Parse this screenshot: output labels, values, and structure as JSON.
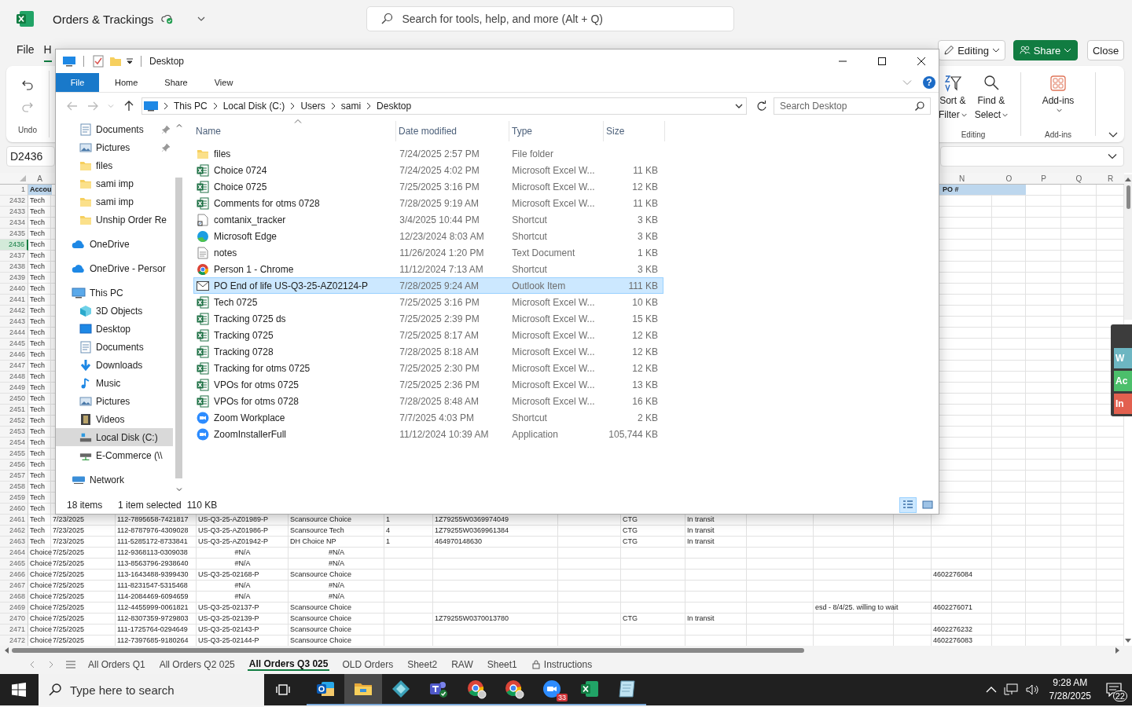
{
  "excel": {
    "title": "Orders & Trackings",
    "search": {
      "placeholder": "Search for tools, help, and more (Alt + Q)"
    },
    "menu_tabs": [
      {
        "label": "File",
        "selected": false
      },
      {
        "label": "H",
        "selected": true
      }
    ],
    "header_buttons": [
      {
        "kind": "editing",
        "label": "Editing"
      },
      {
        "kind": "share",
        "label": "Share"
      },
      {
        "kind": "close",
        "label": "Close"
      }
    ],
    "ribbon": {
      "undo_group": "Undo",
      "editing_commands": [
        {
          "kind": "sort",
          "line1": "Sort &",
          "line2": "Filter"
        },
        {
          "kind": "find",
          "line1": "Find &",
          "line2": "Select"
        }
      ],
      "editing_group": "Editing",
      "addins_command": "Add-ins",
      "addins_group": "Add-ins"
    },
    "name_box": "D2436",
    "column_headers": {
      "column_a": "A",
      "column_n": "N",
      "column_o": "O",
      "column_p": "P",
      "column_q": "Q",
      "column_r": "R"
    },
    "rows": [
      {
        "n": "1",
        "kind": "header",
        "selected": false,
        "column_a": "Accou",
        "column_n": "PO #"
      },
      {
        "n": "2432",
        "kind": "normal",
        "selected": false,
        "column_a": "Tech"
      },
      {
        "n": "2433",
        "kind": "normal",
        "selected": false,
        "column_a": "Tech"
      },
      {
        "n": "2434",
        "kind": "normal",
        "selected": false,
        "column_a": "Tech"
      },
      {
        "n": "2435",
        "kind": "normal",
        "selected": false,
        "column_a": "Tech"
      },
      {
        "n": "2436",
        "kind": "normal",
        "selected": true,
        "column_a": "Tech"
      },
      {
        "n": "2437",
        "kind": "normal",
        "selected": false,
        "column_a": "Tech"
      },
      {
        "n": "2438",
        "kind": "normal",
        "selected": false,
        "column_a": "Tech"
      },
      {
        "n": "2439",
        "kind": "normal",
        "selected": false,
        "column_a": "Tech"
      },
      {
        "n": "2440",
        "kind": "normal",
        "selected": false,
        "column_a": "Tech"
      },
      {
        "n": "2441",
        "kind": "normal",
        "selected": false,
        "column_a": "Tech"
      },
      {
        "n": "2442",
        "kind": "normal",
        "selected": false,
        "column_a": "Tech"
      },
      {
        "n": "2443",
        "kind": "normal",
        "selected": false,
        "column_a": "Tech"
      },
      {
        "n": "2444",
        "kind": "normal",
        "selected": false,
        "column_a": "Tech"
      },
      {
        "n": "2445",
        "kind": "normal",
        "selected": false,
        "column_a": "Tech"
      },
      {
        "n": "2446",
        "kind": "normal",
        "selected": false,
        "column_a": "Tech"
      },
      {
        "n": "2447",
        "kind": "normal",
        "selected": false,
        "column_a": "Tech"
      },
      {
        "n": "2448",
        "kind": "normal",
        "selected": false,
        "column_a": "Tech"
      },
      {
        "n": "2449",
        "kind": "normal",
        "selected": false,
        "column_a": "Tech"
      },
      {
        "n": "2450",
        "kind": "normal",
        "selected": false,
        "column_a": "Tech"
      },
      {
        "n": "2451",
        "kind": "normal",
        "selected": false,
        "column_a": "Tech"
      },
      {
        "n": "2452",
        "kind": "normal",
        "selected": false,
        "column_a": "Tech"
      },
      {
        "n": "2453",
        "kind": "normal",
        "selected": false,
        "column_a": "Tech"
      },
      {
        "n": "2454",
        "kind": "normal",
        "selected": false,
        "column_a": "Tech"
      },
      {
        "n": "2455",
        "kind": "normal",
        "selected": false,
        "column_a": "Tech"
      },
      {
        "n": "2456",
        "kind": "normal",
        "selected": false,
        "column_a": "Tech"
      },
      {
        "n": "2457",
        "kind": "normal",
        "selected": false,
        "column_a": "Tech"
      },
      {
        "n": "2458",
        "kind": "normal",
        "selected": false,
        "column_a": "Tech"
      },
      {
        "n": "2459",
        "kind": "normal",
        "selected": false,
        "column_a": "Tech"
      },
      {
        "n": "2460",
        "kind": "normal",
        "selected": false,
        "column_a": "Tech"
      },
      {
        "n": "2461",
        "kind": "normal",
        "selected": false,
        "column_a": "Tech",
        "column_b": "7/23/2025",
        "column_c": "112-7895658-7421817",
        "column_d": "US-Q3-25-AZ01989-P",
        "column_e": "Scansource Choice",
        "column_f": "1",
        "column_g": "1Z79255W0369974049",
        "column_i": "CTG",
        "column_j": "In transit"
      },
      {
        "n": "2462",
        "kind": "normal",
        "selected": false,
        "column_a": "Tech",
        "column_b": "7/23/2025",
        "column_c": "112-8787976-4309028",
        "column_d": "US-Q3-25-AZ01986-P",
        "column_e": "Scansource Tech",
        "column_f": "4",
        "column_g": "1Z79255W0369961384",
        "column_i": "CTG",
        "column_j": "In transit"
      },
      {
        "n": "2463",
        "kind": "normal",
        "selected": false,
        "column_a": "Tech",
        "column_b": "7/23/2025",
        "column_c": "111-5285172-8733841",
        "column_d": "US-Q3-25-AZ01942-P",
        "column_e": "DH Choice NP",
        "column_f": "1",
        "column_g": "464970148630",
        "column_i": "CTG",
        "column_j": "In transit"
      },
      {
        "n": "2464",
        "kind": "missing",
        "selected": false,
        "column_a": "Choice",
        "column_b": "7/25/2025",
        "column_c": "112-9368113-0309038",
        "column_d": "#N/A",
        "column_e": "#N/A"
      },
      {
        "n": "2465",
        "kind": "missing",
        "selected": false,
        "column_a": "Choice",
        "column_b": "7/25/2025",
        "column_c": "113-8563796-2938640",
        "column_d": "#N/A",
        "column_e": "#N/A"
      },
      {
        "n": "2466",
        "kind": "normal",
        "selected": false,
        "column_a": "Choice",
        "column_b": "7/25/2025",
        "column_c": "113-1643488-9399430",
        "column_d": "US-Q3-25-02168-P",
        "column_e": "Scansource Choice",
        "column_n": "4602276084"
      },
      {
        "n": "2467",
        "kind": "missing",
        "selected": false,
        "column_a": "Choice",
        "column_b": "7/25/2025",
        "column_c": "111-8231547-5315468",
        "column_d": "#N/A",
        "column_e": "#N/A"
      },
      {
        "n": "2468",
        "kind": "missing",
        "selected": false,
        "column_a": "Choice",
        "column_b": "7/25/2025",
        "column_c": "114-2084469-6094659",
        "column_d": "#N/A",
        "column_e": "#N/A"
      },
      {
        "n": "2469",
        "kind": "normal",
        "selected": false,
        "column_a": "Choice",
        "column_b": "7/25/2025",
        "column_c": "112-4455999-0061821",
        "column_d": "US-Q3-25-02137-P",
        "column_e": "Scansource Choice",
        "column_l": "esd -  8/4/25. willing to wait",
        "column_n": "4602276071"
      },
      {
        "n": "2470",
        "kind": "normal",
        "selected": false,
        "column_a": "Choice",
        "column_b": "7/25/2025",
        "column_c": "112-8307359-9729803",
        "column_d": "US-Q3-25-02139-P",
        "column_e": "Scansource Choice",
        "column_g": "1Z79255W0370013780",
        "column_i": "CTG",
        "column_j": "In transit"
      },
      {
        "n": "2471",
        "kind": "normal",
        "selected": false,
        "column_a": "Choice",
        "column_b": "7/25/2025",
        "column_c": "111-1725764-0294649",
        "column_d": "US-Q3-25-02143-P",
        "column_e": "Scansource Choice",
        "column_n": "4602276232"
      },
      {
        "n": "2472",
        "kind": "normal",
        "selected": false,
        "column_a": "Choice",
        "column_b": "7/25/2025",
        "column_c": "112-7397685-9180264",
        "column_d": "US-Q3-25-02144-P",
        "column_e": "Scansource Choice",
        "column_n": "4602276083"
      }
    ],
    "side_widget": [
      {
        "label": "W",
        "color": "#6db6c2"
      },
      {
        "label": "Ac",
        "color": "#4cbf6b"
      },
      {
        "label": "In",
        "color": "#e2604f"
      }
    ],
    "sheet_tabs": [
      {
        "label": "All Orders Q1",
        "selected": false,
        "locked": false
      },
      {
        "label": "All Orders Q2 025",
        "selected": false,
        "locked": false
      },
      {
        "label": "All Orders Q3 025",
        "selected": true,
        "locked": false
      },
      {
        "label": "OLD Orders",
        "selected": false,
        "locked": false
      },
      {
        "label": "Sheet2",
        "selected": false,
        "locked": false
      },
      {
        "label": "RAW",
        "selected": false,
        "locked": false
      },
      {
        "label": "Sheet1",
        "selected": false,
        "locked": false
      },
      {
        "label": "Instructions",
        "selected": false,
        "locked": true
      }
    ]
  },
  "explorer": {
    "title": "Desktop",
    "ribbon_tabs": [
      {
        "label": "File",
        "selected": true
      },
      {
        "label": "Home",
        "selected": false
      },
      {
        "label": "Share",
        "selected": false
      },
      {
        "label": "View",
        "selected": false
      }
    ],
    "help": "?",
    "breadcrumb": [
      "This PC",
      "Local Disk (C:)",
      "Users",
      "sami",
      "Desktop"
    ],
    "search": {
      "placeholder": "Search Desktop"
    },
    "quick_access": [
      {
        "label": "Documents",
        "kind": "documents",
        "pinned": true,
        "selected": false
      },
      {
        "label": "Pictures",
        "kind": "pictures",
        "pinned": true,
        "selected": false
      },
      {
        "label": "files",
        "kind": "folder",
        "pinned": false,
        "selected": false
      },
      {
        "label": "sami imp",
        "kind": "folder",
        "pinned": false,
        "selected": false
      },
      {
        "label": "sami imp",
        "kind": "folder",
        "pinned": false,
        "selected": false
      },
      {
        "label": "Unship Order Re",
        "kind": "folder",
        "pinned": false,
        "selected": false
      }
    ],
    "tree": [
      {
        "label": "OneDrive",
        "kind": "cloud",
        "selected": false
      },
      {
        "label": "OneDrive - Persor",
        "kind": "cloud",
        "selected": false
      },
      {
        "label": "This PC",
        "kind": "pc",
        "selected": false,
        "children": [
          {
            "label": "3D Objects",
            "kind": "cube",
            "selected": false
          },
          {
            "label": "Desktop",
            "kind": "desktop",
            "selected": false
          },
          {
            "label": "Documents",
            "kind": "documents",
            "selected": false
          },
          {
            "label": "Downloads",
            "kind": "download",
            "selected": false
          },
          {
            "label": "Music",
            "kind": "music",
            "selected": false
          },
          {
            "label": "Pictures",
            "kind": "pictures",
            "selected": false
          },
          {
            "label": "Videos",
            "kind": "videos",
            "selected": false
          },
          {
            "label": "Local Disk (C:)",
            "kind": "disk",
            "selected": true
          },
          {
            "label": "E-Commerce (\\\\",
            "kind": "netdrive",
            "selected": false
          }
        ]
      },
      {
        "label": "Network",
        "kind": "network",
        "selected": false
      }
    ],
    "columns": [
      "Name",
      "Date modified",
      "Type",
      "Size"
    ],
    "files": [
      {
        "name": "files",
        "date": "7/24/2025 2:57 PM",
        "type": "File folder",
        "kind": "folder",
        "selected": false
      },
      {
        "name": "Choice 0724",
        "date": "7/24/2025 4:02 PM",
        "type": "Microsoft Excel W...",
        "size": "11 KB",
        "kind": "excel",
        "selected": false
      },
      {
        "name": "Choice 0725",
        "date": "7/25/2025 3:16 PM",
        "type": "Microsoft Excel W...",
        "size": "12 KB",
        "kind": "excel",
        "selected": false
      },
      {
        "name": "Comments for otms 0728",
        "date": "7/28/2025 9:19 AM",
        "type": "Microsoft Excel W...",
        "size": "11 KB",
        "kind": "excel",
        "selected": false
      },
      {
        "name": "comtanix_tracker",
        "date": "3/4/2025 10:44 PM",
        "type": "Shortcut",
        "size": "3 KB",
        "kind": "shortcut",
        "selected": false
      },
      {
        "name": "Microsoft Edge",
        "date": "12/23/2024 8:03 AM",
        "type": "Shortcut",
        "size": "3 KB",
        "kind": "edge",
        "selected": false
      },
      {
        "name": "notes",
        "date": "11/26/2024 1:20 PM",
        "type": "Text Document",
        "size": "1 KB",
        "kind": "text",
        "selected": false
      },
      {
        "name": "Person 1 - Chrome",
        "date": "11/12/2024 7:13 AM",
        "type": "Shortcut",
        "size": "3 KB",
        "kind": "chrome",
        "selected": false
      },
      {
        "name": "PO End of life  US-Q3-25-AZ02124-P",
        "date": "7/28/2025 9:24 AM",
        "type": "Outlook Item",
        "size": "111 KB",
        "kind": "mail",
        "selected": true
      },
      {
        "name": "Tech 0725",
        "date": "7/25/2025 3:16 PM",
        "type": "Microsoft Excel W...",
        "size": "10 KB",
        "kind": "excel",
        "selected": false
      },
      {
        "name": "Tracking 0725 ds",
        "date": "7/25/2025 2:39 PM",
        "type": "Microsoft Excel W...",
        "size": "15 KB",
        "kind": "excel",
        "selected": false
      },
      {
        "name": "Tracking 0725",
        "date": "7/25/2025 8:17 AM",
        "type": "Microsoft Excel W...",
        "size": "12 KB",
        "kind": "excel",
        "selected": false
      },
      {
        "name": "Tracking 0728",
        "date": "7/28/2025 8:18 AM",
        "type": "Microsoft Excel W...",
        "size": "12 KB",
        "kind": "excel",
        "selected": false
      },
      {
        "name": "Tracking for otms 0725",
        "date": "7/25/2025 2:30 PM",
        "type": "Microsoft Excel W...",
        "size": "12 KB",
        "kind": "excel",
        "selected": false
      },
      {
        "name": "VPOs for otms 0725",
        "date": "7/25/2025 2:36 PM",
        "type": "Microsoft Excel W...",
        "size": "13 KB",
        "kind": "excel",
        "selected": false
      },
      {
        "name": "VPOs for otms 0728",
        "date": "7/28/2025 8:48 AM",
        "type": "Microsoft Excel W...",
        "size": "16 KB",
        "kind": "excel",
        "selected": false
      },
      {
        "name": "Zoom Workplace",
        "date": "7/7/2025 4:03 PM",
        "type": "Shortcut",
        "size": "2 KB",
        "kind": "zoom",
        "selected": false
      },
      {
        "name": "ZoomInstallerFull",
        "date": "11/12/2024 10:39 AM",
        "type": "Application",
        "size": "105,744 KB",
        "kind": "zoom",
        "selected": false
      }
    ],
    "status": {
      "count": "18 items",
      "selection": "1 item selected",
      "size": "110 KB"
    },
    "view_buttons": [
      {
        "kind": "details",
        "selected": true
      },
      {
        "kind": "tiles",
        "selected": false
      }
    ]
  },
  "taskbar": {
    "search": {
      "placeholder": "Type here to search"
    },
    "apps": [
      {
        "kind": "outlook",
        "active": false
      },
      {
        "kind": "explorer",
        "active": true
      },
      {
        "kind": "diamond",
        "active": false
      },
      {
        "kind": "teams",
        "active": false
      },
      {
        "kind": "chrome",
        "active": false
      },
      {
        "kind": "chrome",
        "active": false
      },
      {
        "kind": "zoom",
        "active": false,
        "badge": "33"
      },
      {
        "kind": "excel",
        "active": false
      },
      {
        "kind": "notepad",
        "active": false
      }
    ],
    "time": "9:28 AM",
    "date": "7/28/2025",
    "notifications": "22"
  }
}
